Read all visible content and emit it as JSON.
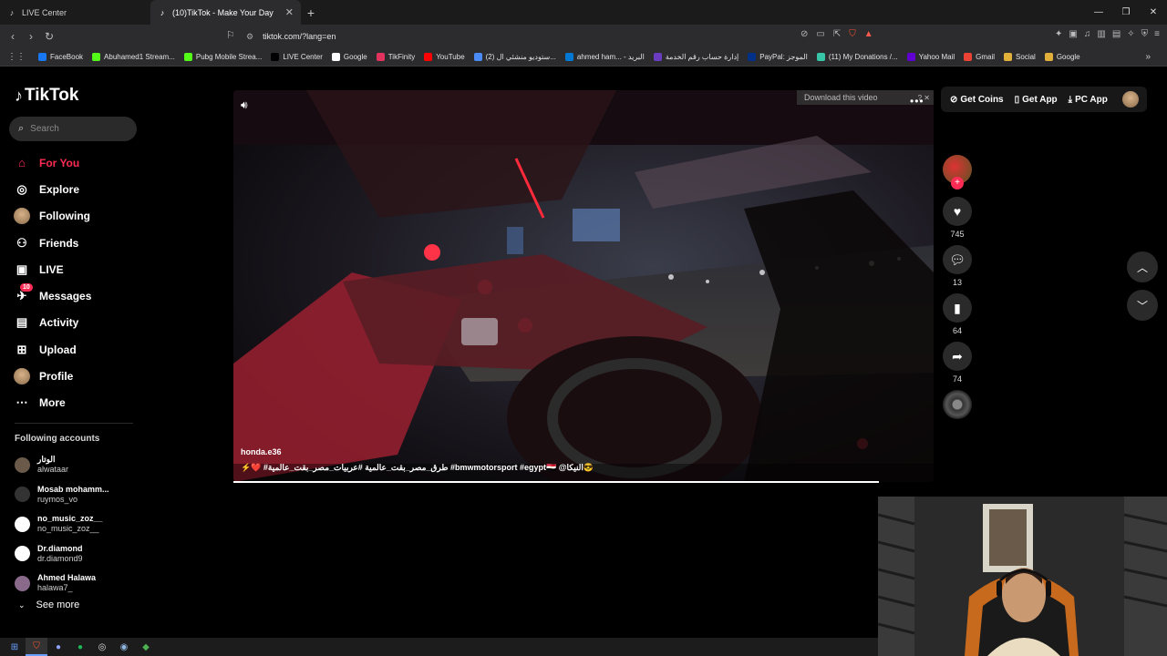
{
  "browser": {
    "tabs": [
      {
        "title": "LIVE Center",
        "icon": "tiktok-icon"
      },
      {
        "title": "(10)TikTok - Make Your Day",
        "icon": "tiktok-icon",
        "active": true
      }
    ],
    "url": "tiktok.com/?lang=en",
    "bookmarks": [
      {
        "label": "FaceBook",
        "color": "#1877f2"
      },
      {
        "label": "Abuhamed1 Stream...",
        "color": "#53fc18"
      },
      {
        "label": "Pubg Mobile Strea...",
        "color": "#53fc18"
      },
      {
        "label": "LIVE Center",
        "color": "#000000"
      },
      {
        "label": "Google",
        "color": "#ffffff"
      },
      {
        "label": "TikFinity",
        "color": "#e2335f"
      },
      {
        "label": "YouTube",
        "color": "#ff0000"
      },
      {
        "label": "(2) ستوديو منشئي ال...",
        "color": "#4b8bf5"
      },
      {
        "label": "ahmed ham... - البريد",
        "color": "#0078d4"
      },
      {
        "label": "إدارة حساب رقم الخدمة",
        "color": "#6a3cbf"
      },
      {
        "label": "PayPal: الموجز",
        "color": "#003087"
      },
      {
        "label": "(11) My Donations /...",
        "color": "#36c5a6"
      },
      {
        "label": "Yahoo Mail",
        "color": "#6001d2"
      },
      {
        "label": "Gmail",
        "color": "#ea4335"
      },
      {
        "label": "Social",
        "color": "#e0b03a"
      },
      {
        "label": "Google",
        "color": "#e0b03a"
      }
    ]
  },
  "app": {
    "logo_text": "TikTok",
    "search_placeholder": "Search",
    "nav": [
      {
        "label": "For You",
        "icon": "home-icon",
        "active": true
      },
      {
        "label": "Explore",
        "icon": "compass-icon"
      },
      {
        "label": "Following",
        "icon": "following-avatar-icon"
      },
      {
        "label": "Friends",
        "icon": "friends-icon"
      },
      {
        "label": "LIVE",
        "icon": "live-icon"
      },
      {
        "label": "Messages",
        "icon": "messages-icon",
        "badge": "10"
      },
      {
        "label": "Activity",
        "icon": "activity-icon"
      },
      {
        "label": "Upload",
        "icon": "upload-icon"
      },
      {
        "label": "Profile",
        "icon": "profile-avatar-icon"
      },
      {
        "label": "More",
        "icon": "more-icon"
      }
    ],
    "following_title": "Following accounts",
    "following": [
      {
        "name": "الوتار",
        "user": "alwataar",
        "color": "#6b5a4a"
      },
      {
        "name": "Mosab mohamm...",
        "user": "ruymos_vo",
        "color": "#333333"
      },
      {
        "name": "no_music_zoz__",
        "user": "no_music_zoz__",
        "color": "#ffffff"
      },
      {
        "name": "Dr.diamond",
        "user": "dr.diamond9",
        "color": "#ffffff"
      },
      {
        "name": "Ahmed Halawa",
        "user": "halawa7_",
        "color": "#8a6a8a"
      }
    ],
    "see_more": "See more",
    "top_actions": {
      "get_coins": "Get Coins",
      "get_app": "Get App",
      "pc_app": "PC App"
    }
  },
  "video": {
    "download_label": "Download this video",
    "author": "honda.e36",
    "caption": "⚡️❤️ #طرق_مصر_بقت_عالمية #عربيات_مصر_بقت_عالمية #bmwmotorsport #egypt🇪🇬 @النيكا😎",
    "progress": 1.0,
    "likes": "745",
    "comments": "13",
    "saves": "64",
    "shares": "74"
  },
  "colors": {
    "accent": "#fe2c55"
  }
}
